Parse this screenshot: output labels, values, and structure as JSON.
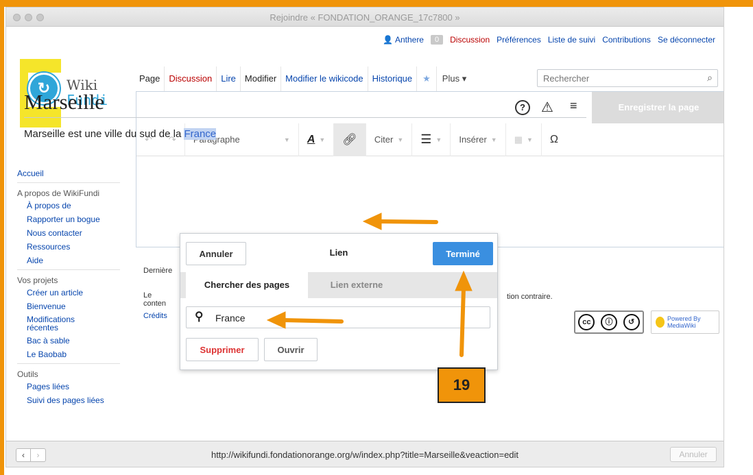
{
  "window": {
    "title": "Rejoindre « FONDATION_ORANGE_17c7800 »"
  },
  "personal": {
    "user": "Anthere",
    "notifications": "0",
    "discussion": "Discussion",
    "preferences": "Préférences",
    "watchlist": "Liste de suivi",
    "contributions": "Contributions",
    "logout": "Se déconnecter"
  },
  "logo": {
    "line1": "Wiki",
    "line2": "Fundi"
  },
  "tabs": {
    "page": "Page",
    "discussion": "Discussion",
    "read": "Lire",
    "edit": "Modifier",
    "edit_source": "Modifier le wikicode",
    "history": "Historique",
    "more": "Plus"
  },
  "search": {
    "placeholder": "Rechercher"
  },
  "editor": {
    "save": "Enregistrer la page",
    "format": "Paragraphe",
    "cite": "Citer",
    "insert": "Insérer",
    "special_char": "Ω"
  },
  "article": {
    "title": "Marseille",
    "text_before": "Marseille est une ville du sud de la ",
    "link_text": "France"
  },
  "sidebar": {
    "home": "Accueil",
    "about_head": "A propos de WikiFundi",
    "about_items": [
      "À propos de",
      "Rapporter un bogue",
      "Nous contacter",
      "Ressources",
      "Aide"
    ],
    "projects_head": "Vos projets",
    "project_items": [
      "Créer un article",
      "Bienvenue",
      "Modifications récentes",
      "Bac à sable",
      "Le Baobab"
    ],
    "tools_head": "Outils",
    "tool_items": [
      "Pages liées",
      "Suivi des pages liées"
    ]
  },
  "footer": {
    "last": "Dernière",
    "content": "Le conten",
    "credits": "Crédits",
    "contrary": "tion contraire."
  },
  "badges": {
    "cc": "cc",
    "mediawiki": "Powered By MediaWiki"
  },
  "popup": {
    "cancel": "Annuler",
    "title": "Lien",
    "done": "Terminé",
    "tab_search": "Chercher des pages",
    "tab_external": "Lien externe",
    "query": "France",
    "remove": "Supprimer",
    "open": "Ouvrir"
  },
  "annotation": {
    "step": "19",
    "color": "#f0940a"
  },
  "statusbar": {
    "url": "http://wikifundi.fondationorange.org/w/index.php?title=Marseille&veaction=edit",
    "cancel": "Annuler"
  },
  "icons": {
    "search": "🔍",
    "star": "★",
    "help": "?",
    "notice": "⚠",
    "menu": "≡"
  }
}
